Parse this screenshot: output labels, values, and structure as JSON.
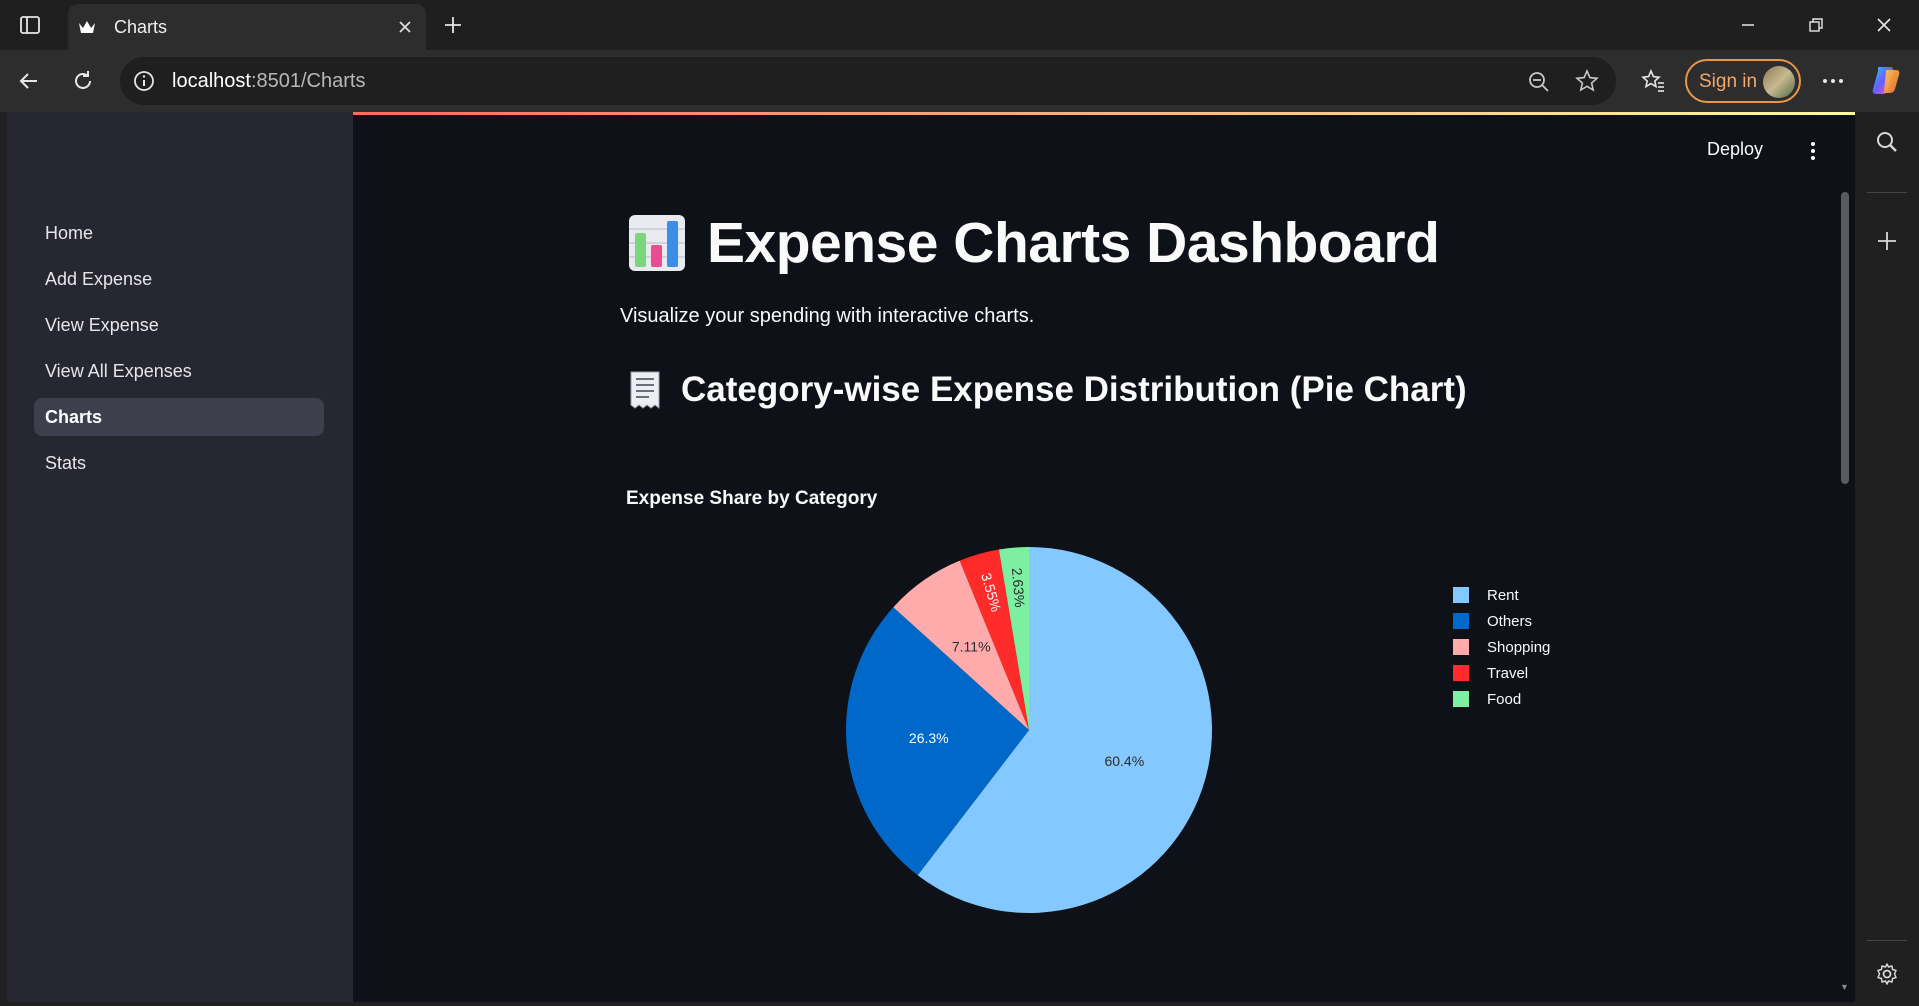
{
  "browser": {
    "tab_title": "Charts",
    "url_host": "localhost",
    "url_rest": ":8501/Charts",
    "signin_label": "Sign in"
  },
  "app": {
    "deploy_label": "Deploy",
    "sidebar": {
      "items": [
        {
          "label": "Home",
          "active": false
        },
        {
          "label": "Add Expense",
          "active": false
        },
        {
          "label": "View Expense",
          "active": false
        },
        {
          "label": "View All Expenses",
          "active": false
        },
        {
          "label": "Charts",
          "active": true
        },
        {
          "label": "Stats",
          "active": false
        }
      ]
    },
    "title_emoji_icon": "bar-chart-emoji",
    "title": "Expense Charts Dashboard",
    "subtitle": "Visualize your spending with interactive charts.",
    "section_icon": "receipt-emoji",
    "section_title": "Category-wise Expense Distribution (Pie Chart)",
    "chart_title": "Expense Share by Category"
  },
  "chart_data": {
    "type": "pie",
    "title": "Expense Share by Category",
    "categories": [
      "Rent",
      "Others",
      "Shopping",
      "Travel",
      "Food"
    ],
    "values": [
      60.4,
      26.3,
      7.11,
      3.55,
      2.63
    ],
    "labels": [
      "60.4%",
      "26.3%",
      "7.11%",
      "3.55%",
      "2.63%"
    ],
    "colors": [
      "#83c9ff",
      "#0068c9",
      "#ffabab",
      "#ff2b2b",
      "#7defa1"
    ],
    "label_colors": [
      "#2b2b2b",
      "#ffffff",
      "#2b2b2b",
      "#ffffff",
      "#2b2b2b"
    ],
    "legend_position": "top-right",
    "direction": "clockwise",
    "start": "top"
  }
}
